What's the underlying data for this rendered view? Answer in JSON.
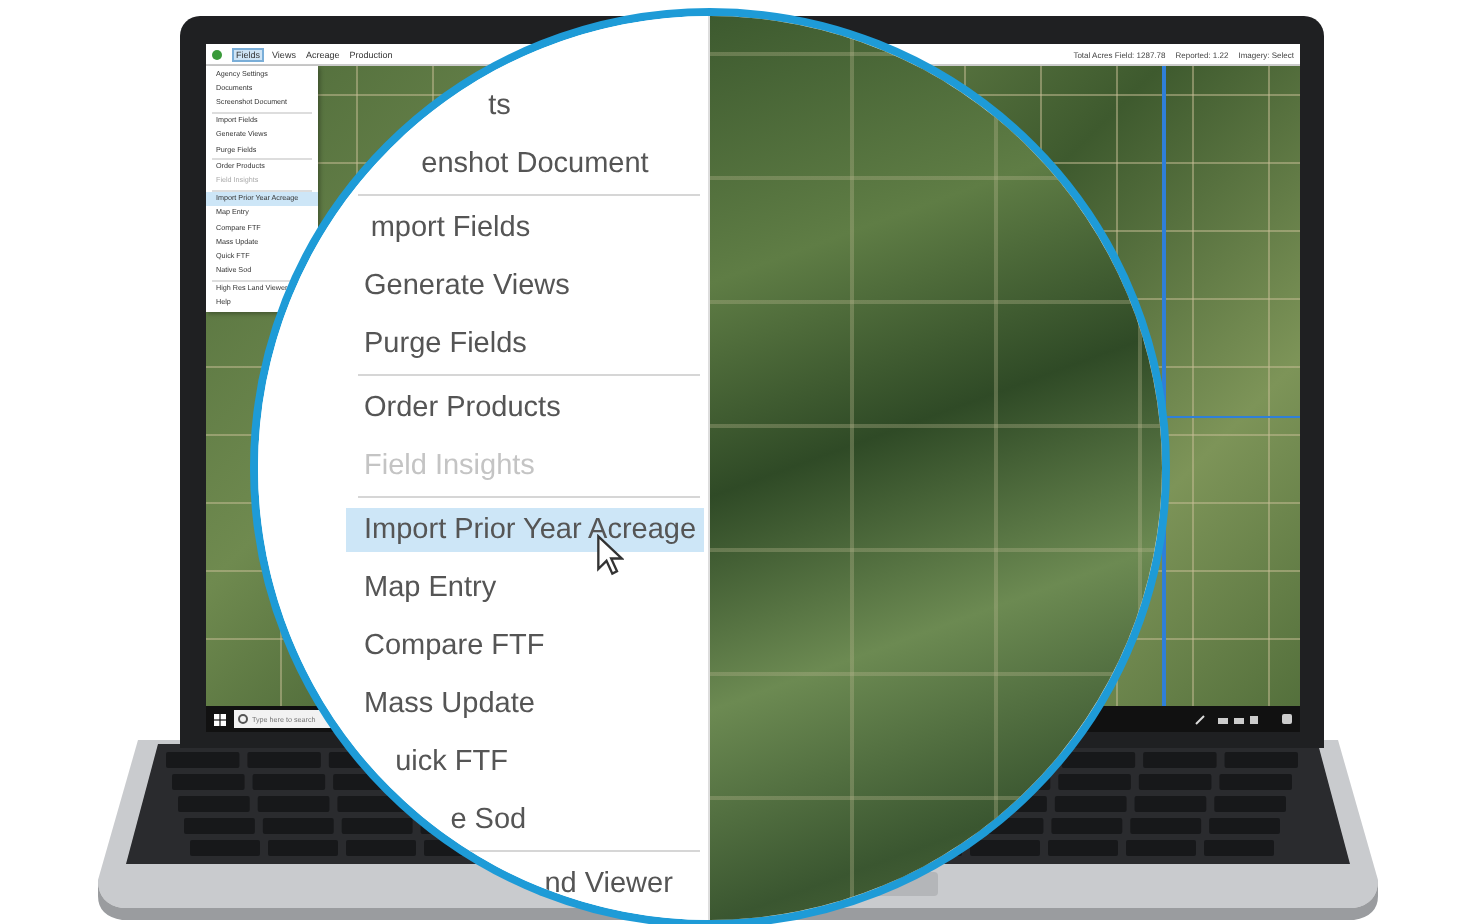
{
  "screen": {
    "menubar": [
      {
        "label": "Fields",
        "selected": true
      },
      {
        "label": "Views",
        "selected": false
      },
      {
        "label": "Acreage",
        "selected": false
      },
      {
        "label": "Production",
        "selected": false
      }
    ],
    "status": [
      "Total Acres Field: 1287.78",
      "Reported: 1.22",
      "Imagery: Select"
    ],
    "menu": [
      [
        {
          "label": "Agency Settings",
          "selected": false,
          "disabled": false
        },
        {
          "label": "Documents",
          "selected": false,
          "disabled": false
        },
        {
          "label": "Screenshot Document",
          "selected": false,
          "disabled": false
        }
      ],
      [
        {
          "label": "Import Fields",
          "selected": false,
          "disabled": false
        },
        {
          "label": "Generate Views",
          "selected": false,
          "disabled": false
        },
        {
          "label": "Purge Fields",
          "selected": false,
          "disabled": false
        }
      ],
      [
        {
          "label": "Order Products",
          "selected": false,
          "disabled": false
        },
        {
          "label": "Field Insights",
          "selected": false,
          "disabled": true
        }
      ],
      [
        {
          "label": "Import Prior Year Acreage",
          "selected": true,
          "disabled": false
        },
        {
          "label": "Map Entry",
          "selected": false,
          "disabled": false
        },
        {
          "label": "Compare FTF",
          "selected": false,
          "disabled": false
        },
        {
          "label": "Mass Update",
          "selected": false,
          "disabled": false
        },
        {
          "label": "Quick FTF",
          "selected": false,
          "disabled": false
        },
        {
          "label": "Native Sod",
          "selected": false,
          "disabled": false
        }
      ],
      [
        {
          "label": "High Res Land Viewer",
          "selected": false,
          "disabled": false
        },
        {
          "label": "Help",
          "selected": false,
          "disabled": false
        }
      ]
    ],
    "taskbar": {
      "search_placeholder": "Type here to search"
    }
  },
  "magnifier": {
    "menu": [
      [
        {
          "label": "ts",
          "selected": false,
          "disabled": false
        },
        {
          "label": "enshot Document",
          "selected": false,
          "disabled": false
        }
      ],
      [
        {
          "label": "mport Fields",
          "selected": false,
          "disabled": false
        },
        {
          "label": "Generate Views",
          "selected": false,
          "disabled": false
        },
        {
          "label": "Purge Fields",
          "selected": false,
          "disabled": false
        }
      ],
      [
        {
          "label": "Order Products",
          "selected": false,
          "disabled": false
        },
        {
          "label": "Field Insights",
          "selected": false,
          "disabled": true
        }
      ],
      [
        {
          "label": "Import Prior Year Acreage",
          "selected": true,
          "disabled": false
        },
        {
          "label": "Map Entry",
          "selected": false,
          "disabled": false
        },
        {
          "label": "Compare FTF",
          "selected": false,
          "disabled": false
        },
        {
          "label": "Mass Update",
          "selected": false,
          "disabled": false
        },
        {
          "label": "uick FTF",
          "selected": false,
          "disabled": false
        },
        {
          "label": "e Sod",
          "selected": false,
          "disabled": false
        }
      ],
      [
        {
          "label": "nd Viewer",
          "selected": false,
          "disabled": false
        }
      ]
    ]
  }
}
